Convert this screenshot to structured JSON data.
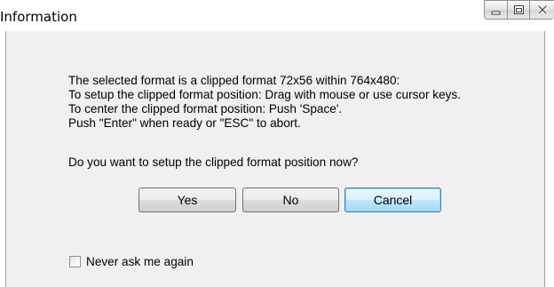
{
  "window": {
    "title": "Information"
  },
  "message": {
    "lines": [
      "The selected format is a clipped format 72x56 within 764x480:",
      "To setup the clipped format position: Drag with mouse or use cursor keys.",
      "To center the clipped format position: Push 'Space'.",
      "Push \"Enter\" when ready or \"ESC\" to abort."
    ],
    "question": "Do you want to setup the clipped format position now?"
  },
  "buttons": {
    "yes": "Yes",
    "no": "No",
    "cancel": "Cancel"
  },
  "checkbox": {
    "label": "Never ask me again",
    "checked": false
  },
  "icons": {
    "minimize": "minimize-icon",
    "maximize": "maximize-icon",
    "close": "close-icon"
  }
}
